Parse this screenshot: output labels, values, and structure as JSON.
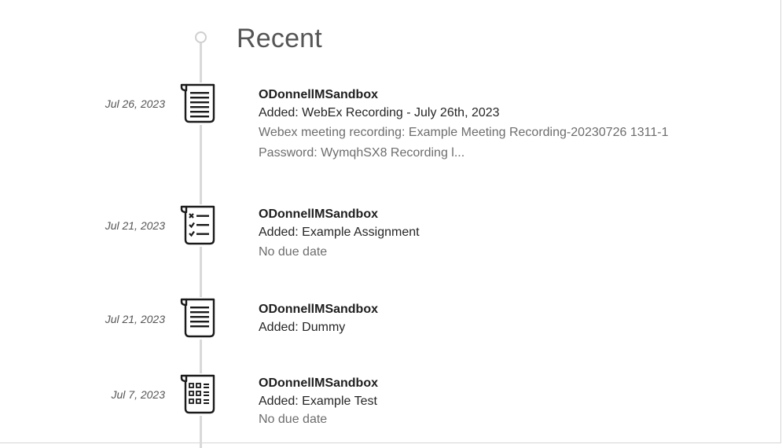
{
  "header": {
    "title": "Recent"
  },
  "entries": [
    {
      "date": "Jul 26, 2023",
      "icon": "document-icon",
      "course": "ODonnellMSandbox",
      "added": "Added: WebEx Recording - July 26th, 2023",
      "description_line1": "Webex meeting recording: Example Meeting Recording-20230726 1311-1",
      "description_line2": "Password: WymqhSX8 Recording l..."
    },
    {
      "date": "Jul 21, 2023",
      "icon": "assignment-icon",
      "course": "ODonnellMSandbox",
      "added": "Added: Example Assignment",
      "description_line1": "No due date"
    },
    {
      "date": "Jul 21, 2023",
      "icon": "document-icon",
      "course": "ODonnellMSandbox",
      "added": "Added: Dummy"
    },
    {
      "date": "Jul 7, 2023",
      "icon": "test-icon",
      "course": "ODonnellMSandbox",
      "added": "Added: Example Test",
      "description_line1": "No due date"
    }
  ]
}
